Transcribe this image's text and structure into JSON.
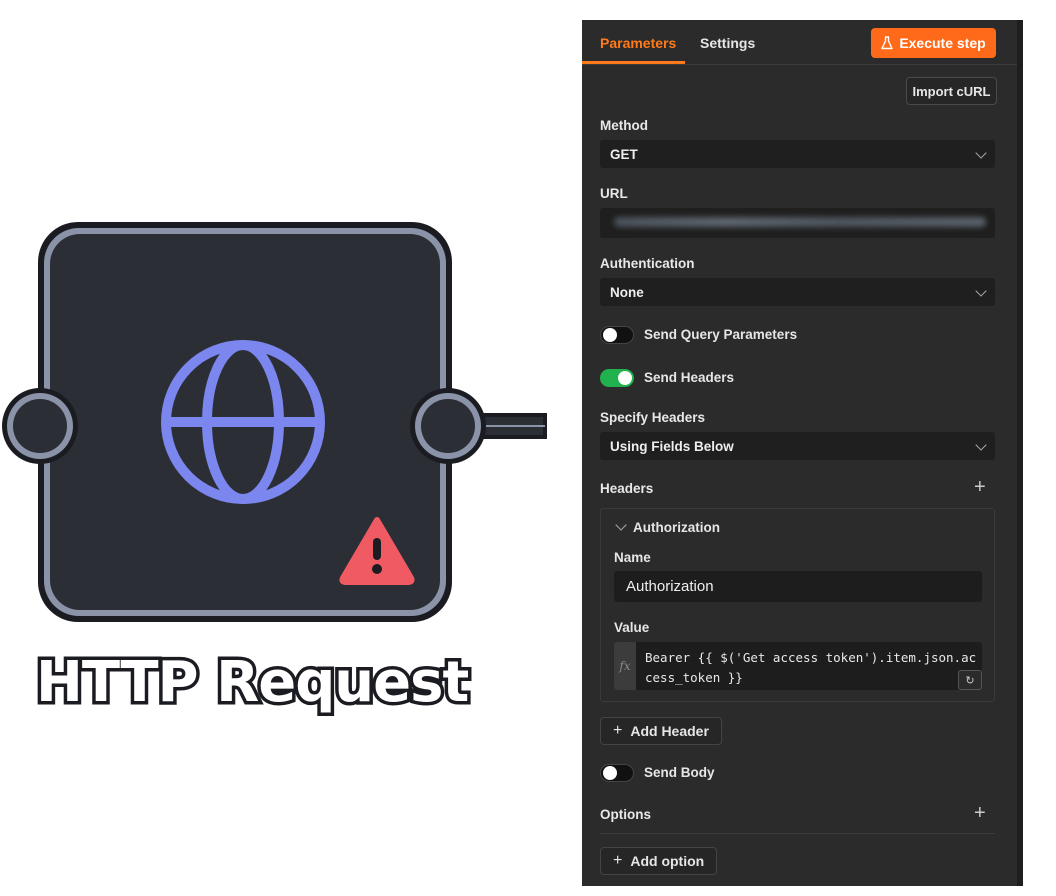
{
  "node": {
    "caption": "HTTP Request",
    "icon": "globe-icon",
    "warning_icon": "warning-icon",
    "colors": {
      "body": "#2c2e36",
      "border": "#8a93a8",
      "globe": "#7b86ee",
      "warning": "#f05a63"
    }
  },
  "panel": {
    "tabs": [
      {
        "label": "Parameters",
        "active": true
      },
      {
        "label": "Settings",
        "active": false
      }
    ],
    "execute_label": "Execute step",
    "import_label": "Import cURL",
    "method": {
      "label": "Method",
      "value": "GET"
    },
    "url": {
      "label": "URL"
    },
    "authentication": {
      "label": "Authentication",
      "value": "None"
    },
    "send_query": {
      "label": "Send Query Parameters",
      "on": false
    },
    "send_headers": {
      "label": "Send Headers",
      "on": true
    },
    "specify_headers": {
      "label": "Specify Headers",
      "value": "Using Fields Below"
    },
    "headers": {
      "label": "Headers",
      "items": [
        {
          "title": "Authorization",
          "name_label": "Name",
          "name_value": "Authorization",
          "value_label": "Value",
          "value_expr": "Bearer {{ $('Get access token').item.json.access_token }}"
        }
      ],
      "add_label": "Add Header"
    },
    "send_body": {
      "label": "Send Body",
      "on": false
    },
    "options": {
      "label": "Options",
      "add_label": "Add option"
    },
    "colors": {
      "accent": "#ff6a1a",
      "toggle_on": "#21b24d",
      "background": "#2b2b2b"
    }
  }
}
